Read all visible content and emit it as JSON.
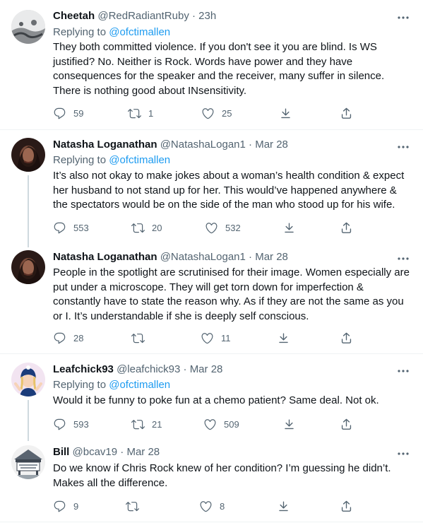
{
  "tweets": [
    {
      "name": "Cheetah",
      "handle": "@RedRadiantRuby",
      "time": "23h",
      "reply_prefix": "Replying to",
      "reply_to": "@ofctimallen",
      "text": "They both committed violence. If you don't see it you are blind. Is WS justified? No. Neither is Rock. Words have power and they have consequences for the speaker and the receiver, many suffer in silence. There is nothing good about INsensitivity.",
      "replies": "59",
      "retweets": "1",
      "likes": "25"
    },
    {
      "name": "Natasha Loganathan",
      "handle": "@NatashaLogan1",
      "time": "Mar 28",
      "reply_prefix": "Replying to",
      "reply_to": "@ofctimallen",
      "text": "It’s also not okay to make jokes about a woman’s health condition & expect her husband to not stand up for her. This would’ve happened anywhere & the spectators would be on the side of the man who stood up for his wife.",
      "replies": "553",
      "retweets": "20",
      "likes": "532"
    },
    {
      "name": "Natasha Loganathan",
      "handle": "@NatashaLogan1",
      "time": "Mar 28",
      "text": "People in the spotlight are scrutinised for their image. Women especially are put under a microscope. They will get torn down for imperfection & constantly have to state the reason why. As if they are not the same as you or I. It’s understandable if she is deeply self conscious.",
      "replies": "28",
      "retweets": "",
      "likes": "11"
    },
    {
      "name": "Leafchick93",
      "handle": "@leafchick93",
      "time": "Mar 28",
      "reply_prefix": "Replying to",
      "reply_to": "@ofctimallen",
      "text": "Would it be funny to poke fun at a chemo patient? Same deal. Not ok.",
      "replies": "593",
      "retweets": "21",
      "likes": "509"
    },
    {
      "name": "Bill",
      "handle": "@bcav19",
      "time": "Mar 28",
      "text": "Do we know if Chris Rock knew of her condition?  I’m guessing he didn’t. Makes all the difference.",
      "replies": "9",
      "retweets": "",
      "likes": "8"
    }
  ],
  "separator": "·",
  "colors": {
    "text": "#0f1419",
    "secondary": "#536471",
    "link": "#1d9bf0",
    "thread_line": "#cfd9de",
    "divider": "#eff3f4"
  },
  "icons": [
    "reply-icon",
    "retweet-icon",
    "like-icon",
    "tip-icon",
    "share-icon",
    "more-icon"
  ]
}
